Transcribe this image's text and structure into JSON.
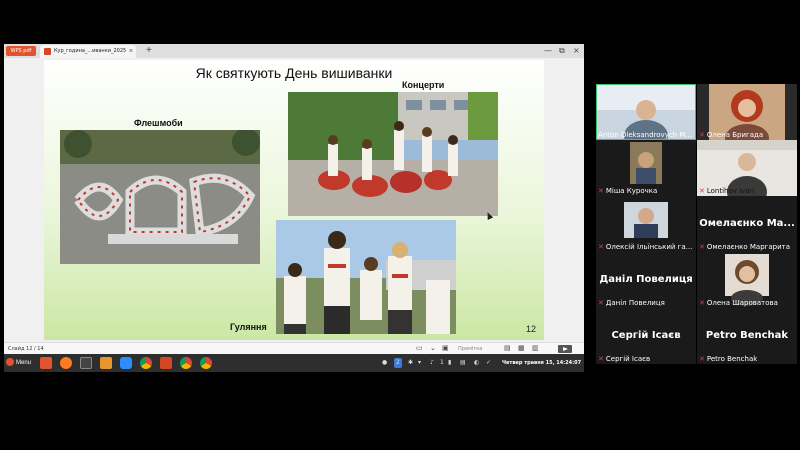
{
  "app": {
    "badge": "WPS pdf"
  },
  "tab": {
    "title": "Кур_година_...иванки_2025",
    "close": "×"
  },
  "toolbar": {
    "new_tab": "+",
    "minimize": "—",
    "restore": "⧉",
    "close": "×"
  },
  "slide": {
    "title": "Як святкують День вишиванки",
    "labels": {
      "flashmob": "Флешмоби",
      "concerts": "Концерти",
      "festivities": "Гуляння"
    },
    "number": "12"
  },
  "statusbar": {
    "counter": "Слайд 12 / 14",
    "notes": "Примітка"
  },
  "taskbar": {
    "menu": "Menu",
    "icons": [
      "wps",
      "firefox",
      "terminal",
      "files",
      "zoom",
      "chrome",
      "presentation",
      "chrome",
      "chrome"
    ],
    "tray": {
      "badge": "2",
      "volume": "1",
      "clock": "Четвер травня 15, 14:24:07"
    }
  },
  "participants": [
    {
      "name": "Anton Oleksandrovych M...",
      "muted": false,
      "active": true,
      "video": true
    },
    {
      "name": "Олена Бригада",
      "muted": true,
      "video": true
    },
    {
      "name": "Міша Курочка",
      "muted": true,
      "video": true
    },
    {
      "name": "Lontihov Ivan",
      "muted": true,
      "video": true
    },
    {
      "name": "Олексій Ільїнський га...",
      "muted": true,
      "video": true
    },
    {
      "name": "Омелаєнко Маргарита",
      "muted": true,
      "video": false,
      "big": "Омелаєнко Ма..."
    },
    {
      "name": "Даніл Повелиця",
      "muted": true,
      "video": false,
      "big": "Даніл Повелиця"
    },
    {
      "name": "Олена Шароватова",
      "muted": true,
      "video": true
    },
    {
      "name": "Сергій Ісаєв",
      "muted": true,
      "video": false,
      "big": "Сергій Ісаєв"
    },
    {
      "name": "Petro Benchak",
      "muted": true,
      "video": false,
      "big": "Petro Benchak"
    }
  ],
  "icons": {
    "mic_muted": "mic-muted-icon"
  },
  "colors": {
    "accent": "#e0552d",
    "active_speaker": "#3ac26b",
    "muted": "#e53935"
  }
}
